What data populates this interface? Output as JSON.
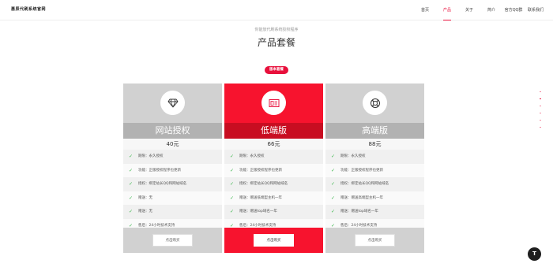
{
  "header": {
    "logo_text": "惠辰代刷系统官网",
    "nav": [
      "首页",
      "产品",
      "关于",
      "简介",
      "官方QQ群",
      "联系我们"
    ],
    "active_index": 1
  },
  "hero": {
    "subtitle": "你能放代刷系统授权程序",
    "title": "产品套餐",
    "tag": "版本套餐"
  },
  "plans": [
    {
      "name": "网站授权",
      "price": "40元",
      "icon": "diamond-icon",
      "features": [
        "期限：永久授权",
        "功能：正版授权程序也更新",
        "授权：绑定站长QQ和网站域名",
        "赠送：无",
        "赠送：无",
        "售后：24小时技术支持"
      ],
      "button": "点击购买"
    },
    {
      "name": "低端版",
      "price": "66元",
      "icon": "server-icon",
      "features": [
        "期限：永久授权",
        "功能：正版授权程序也更新",
        "授权：绑定站长QQ和网站域名",
        "赠送：赠送低端型主机一年",
        "赠送：赠送top域名一年",
        "售后：24小时技术支持"
      ],
      "button": "点击购买"
    },
    {
      "name": "高端版",
      "price": "88元",
      "icon": "lifebuoy-icon",
      "features": [
        "期限：永久授权",
        "功能：正版授权程序也更新",
        "授权：绑定站长QQ和网站域名",
        "赠送：赠送高端型主机一年",
        "赠送：赠送top域名一年",
        "售后：24小时技术支持"
      ],
      "button": "点击购买"
    }
  ],
  "scroll_top_label": "T",
  "colors": {
    "accent": "#e8103c",
    "gray": "#d1d1d1",
    "check": "#3ab54a"
  }
}
